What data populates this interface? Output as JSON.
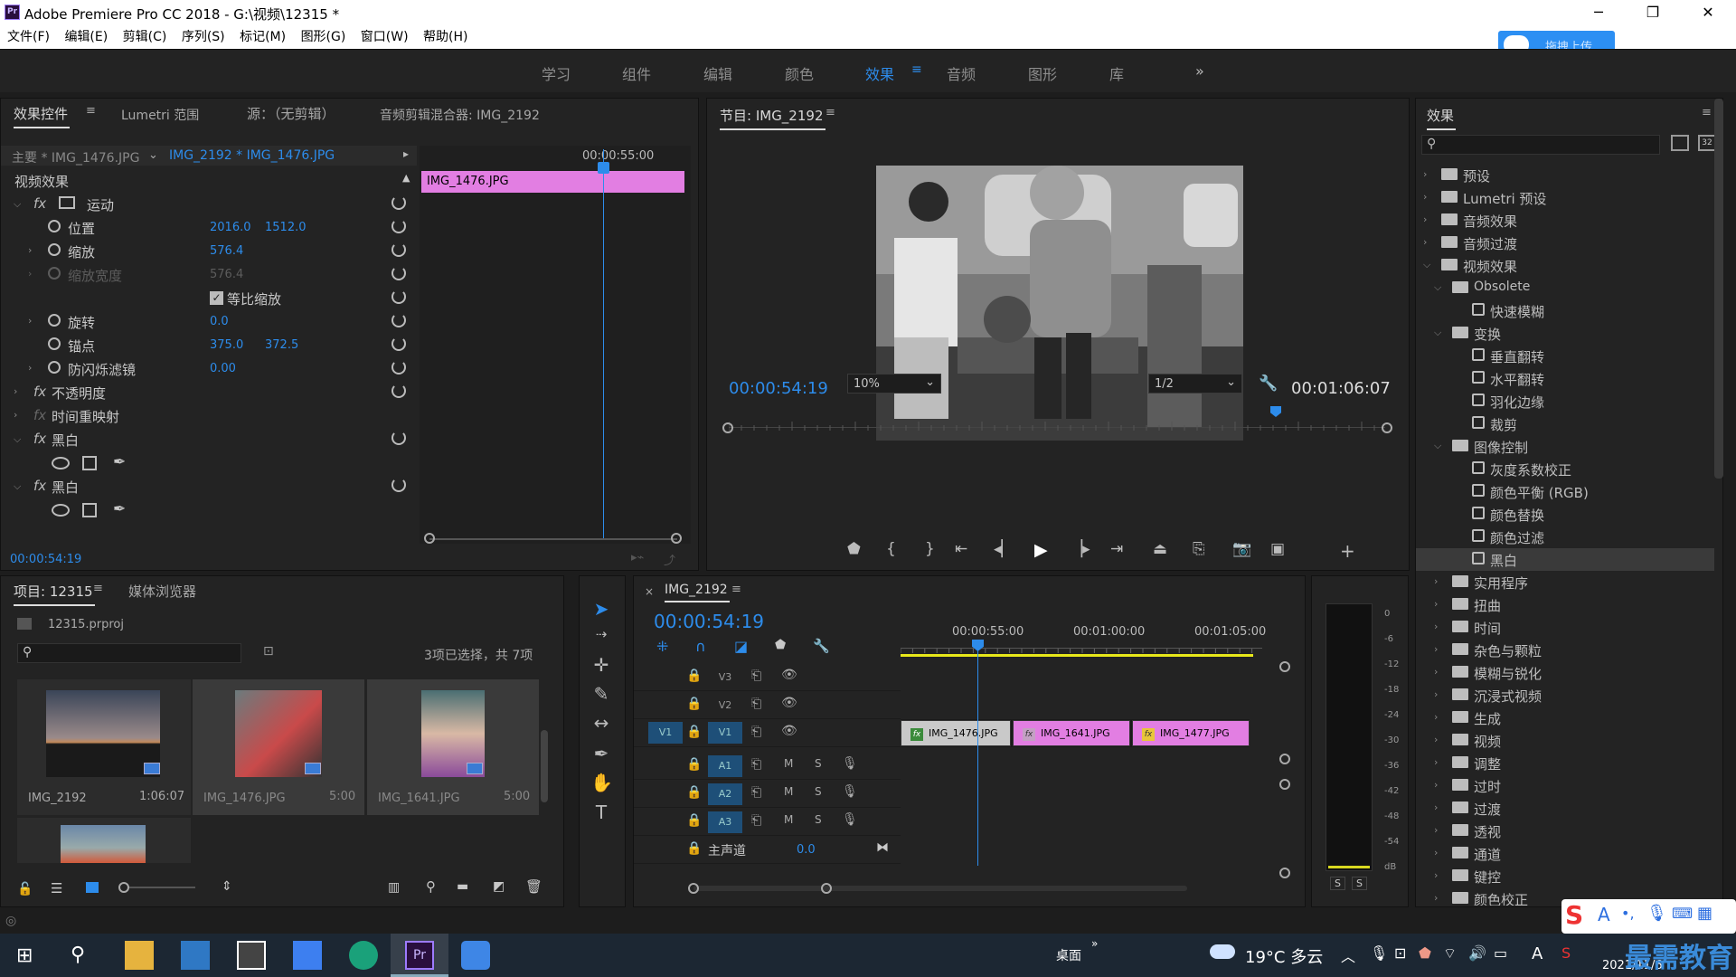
{
  "window": {
    "title": "Adobe Premiere Pro CC 2018 - G:\\视频\\12315 *",
    "app_icon": "Pr"
  },
  "menu": [
    "文件(F)",
    "编辑(E)",
    "剪辑(C)",
    "序列(S)",
    "标记(M)",
    "图形(G)",
    "窗口(W)",
    "帮助(H)"
  ],
  "upload_label": "拖拽上传",
  "workspaces": [
    "学习",
    "组件",
    "编辑",
    "颜色",
    "效果",
    "音频",
    "图形",
    "库"
  ],
  "workspace_active": "效果",
  "effect_controls": {
    "tabs": [
      "效果控件",
      "Lumetri 范围",
      "源：（无剪辑）",
      "音频剪辑混合器: IMG_2192"
    ],
    "master_label": "主要 * IMG_1476.JPG",
    "clip_label": "IMG_2192 * IMG_1476.JPG",
    "mini_time": "00:00:55:00",
    "mini_clip": "IMG_1476.JPG",
    "section": "视频效果",
    "motion": "运动",
    "position_label": "位置",
    "position_x": "2016.0",
    "position_y": "1512.0",
    "scale_label": "缩放",
    "scale_val": "576.4",
    "scale_w_label": "缩放宽度",
    "scale_w_val": "576.4",
    "uniform_label": "等比缩放",
    "rotation_label": "旋转",
    "rotation_val": "0.0",
    "anchor_label": "锚点",
    "anchor_x": "375.0",
    "anchor_y": "372.5",
    "flicker_label": "防闪烁滤镜",
    "flicker_val": "0.00",
    "opacity_label": "不透明度",
    "remap_label": "时间重映射",
    "bw1_label": "黑白",
    "bw2_label": "黑白",
    "timecode": "00:00:54:19"
  },
  "program": {
    "title": "节目: IMG_2192",
    "timecode": "00:00:54:19",
    "zoom": "10%",
    "resolution": "1/2",
    "duration": "00:01:06:07"
  },
  "effects_panel": {
    "title": "效果",
    "items": [
      {
        "label": "预设",
        "level": 0,
        "kind": "folder-star"
      },
      {
        "label": "Lumetri 预设",
        "level": 0,
        "kind": "folder-star"
      },
      {
        "label": "音频效果",
        "level": 0,
        "kind": "folder"
      },
      {
        "label": "音频过渡",
        "level": 0,
        "kind": "folder"
      },
      {
        "label": "视频效果",
        "level": 0,
        "kind": "folder",
        "open": true
      },
      {
        "label": "Obsolete",
        "level": 1,
        "kind": "folder",
        "open": true
      },
      {
        "label": "快速模糊",
        "level": 2,
        "kind": "preset"
      },
      {
        "label": "变换",
        "level": 1,
        "kind": "folder",
        "open": true
      },
      {
        "label": "垂直翻转",
        "level": 2,
        "kind": "preset"
      },
      {
        "label": "水平翻转",
        "level": 2,
        "kind": "preset"
      },
      {
        "label": "羽化边缘",
        "level": 2,
        "kind": "preset"
      },
      {
        "label": "裁剪",
        "level": 2,
        "kind": "preset"
      },
      {
        "label": "图像控制",
        "level": 1,
        "kind": "folder",
        "open": true
      },
      {
        "label": "灰度系数校正",
        "level": 2,
        "kind": "preset"
      },
      {
        "label": "颜色平衡 (RGB)",
        "level": 2,
        "kind": "preset"
      },
      {
        "label": "颜色替换",
        "level": 2,
        "kind": "preset"
      },
      {
        "label": "颜色过滤",
        "level": 2,
        "kind": "preset"
      },
      {
        "label": "黑白",
        "level": 2,
        "kind": "preset",
        "selected": true
      },
      {
        "label": "实用程序",
        "level": 1,
        "kind": "folder"
      },
      {
        "label": "扭曲",
        "level": 1,
        "kind": "folder"
      },
      {
        "label": "时间",
        "level": 1,
        "kind": "folder"
      },
      {
        "label": "杂色与颗粒",
        "level": 1,
        "kind": "folder"
      },
      {
        "label": "模糊与锐化",
        "level": 1,
        "kind": "folder"
      },
      {
        "label": "沉浸式视频",
        "level": 1,
        "kind": "folder"
      },
      {
        "label": "生成",
        "level": 1,
        "kind": "folder"
      },
      {
        "label": "视频",
        "level": 1,
        "kind": "folder"
      },
      {
        "label": "调整",
        "level": 1,
        "kind": "folder"
      },
      {
        "label": "过时",
        "level": 1,
        "kind": "folder"
      },
      {
        "label": "过渡",
        "level": 1,
        "kind": "folder"
      },
      {
        "label": "透视",
        "level": 1,
        "kind": "folder"
      },
      {
        "label": "通道",
        "level": 1,
        "kind": "folder"
      },
      {
        "label": "键控",
        "level": 1,
        "kind": "folder"
      },
      {
        "label": "颜色校正",
        "level": 1,
        "kind": "folder"
      }
    ]
  },
  "project": {
    "tabs": [
      "项目: 12315",
      "媒体浏览器"
    ],
    "file": "12315.prproj",
    "selection": "3项已选择，共 7项",
    "items": [
      {
        "name": "IMG_2192",
        "dur": "1:06:07"
      },
      {
        "name": "IMG_1476.JPG",
        "dur": "5:00"
      },
      {
        "name": "IMG_1641.JPG",
        "dur": "5:00"
      }
    ]
  },
  "timeline": {
    "title": "IMG_2192",
    "timecode": "00:00:54:19",
    "ruler": [
      "00:00:55:00",
      "00:01:00:00",
      "00:01:05:00"
    ],
    "tracks_v": [
      "V3",
      "V2",
      "V1"
    ],
    "tracks_a": [
      "A1",
      "A2",
      "A3"
    ],
    "src_v": "V1",
    "master": "主声道",
    "master_val": "0.0",
    "clips": [
      "IMG_1476.JPG",
      "IMG_1641.JPG",
      "IMG_1477.JPG"
    ]
  },
  "meter": {
    "ticks": [
      "0",
      "-6",
      "-12",
      "-18",
      "-24",
      "-30",
      "-36",
      "-42",
      "-48",
      "-54",
      "dB"
    ],
    "solo": [
      "S",
      "S"
    ]
  },
  "taskbar": {
    "desktop": "桌面",
    "weather": "19°C 多云",
    "ime": "A",
    "year": "2021/11/6",
    "watermark": "最需教育"
  },
  "colors": {
    "accent": "#2d8ceb",
    "clip_pink": "#e27ee2",
    "yellow": "#e8e81a"
  }
}
